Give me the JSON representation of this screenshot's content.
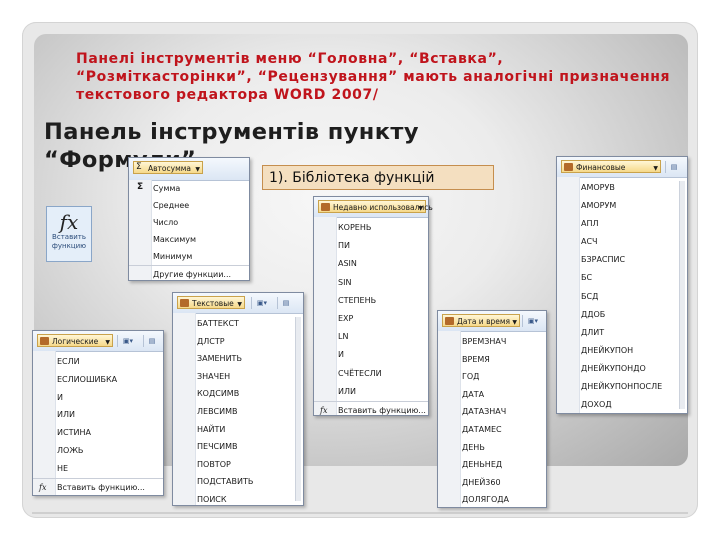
{
  "slide": {
    "intro": "Панелі інструментів меню “Головна”, “Вставка”, “Розміткасторінки”, “Рецензування” мають аналогічні призначення текстового редактора WORD 2007/",
    "title_line1": "Панель інструментів пункту",
    "title_line2": "“Формули”",
    "library_label": "1). Бібліотека функцій"
  },
  "insert_function_button": {
    "symbol": "fx",
    "caption_line1": "Вставить",
    "caption_line2": "функцию"
  },
  "autosum_menu": {
    "header": "Автосумма",
    "icon": "sigma-icon",
    "items": [
      "Сумма",
      "Среднее",
      "Число",
      "Максимум",
      "Минимум"
    ],
    "more": "Другие функции..."
  },
  "recent_menu": {
    "header": "Недавно использовались",
    "items": [
      "КОРЕНЬ",
      "ПИ",
      "ASIN",
      "SIN",
      "СТЕПЕНЬ",
      "EXP",
      "LN",
      "И",
      "СЧЁТЕСЛИ",
      "ИЛИ"
    ],
    "insert": "Вставить функцию..."
  },
  "financial_menu": {
    "header": "Финансовые",
    "items": [
      "АМОРУВ",
      "АМОРУМ",
      "АПЛ",
      "АСЧ",
      "БЗРАСПИС",
      "БС",
      "БСД",
      "ДДОБ",
      "ДЛИТ",
      "ДНЕЙКУПОН",
      "ДНЕЙКУПОНДО",
      "ДНЕЙКУПОНПОСЛЕ",
      "ДОХОД"
    ]
  },
  "text_menu": {
    "header": "Текстовые",
    "items": [
      "БАТТЕКСТ",
      "ДЛСТР",
      "ЗАМЕНИТЬ",
      "ЗНАЧЕН",
      "КОДСИМВ",
      "ЛЕВСИМВ",
      "НАЙТИ",
      "ПЕЧСИМВ",
      "ПОВТОР",
      "ПОДСТАВИТЬ",
      "ПОИСК"
    ]
  },
  "logical_menu": {
    "header": "Логические",
    "items": [
      "ЕСЛИ",
      "ЕСЛИОШИБКА",
      "И",
      "ИЛИ",
      "ИСТИНА",
      "ЛОЖЬ",
      "НЕ"
    ],
    "insert": "Вставить функцию..."
  },
  "datetime_menu": {
    "header": "Дата и время",
    "items": [
      "ВРЕМЗНАЧ",
      "ВРЕМЯ",
      "ГОД",
      "ДАТА",
      "ДАТАЗНАЧ",
      "ДАТАМЕС",
      "ДЕНЬ",
      "ДЕНЬНЕД",
      "ДНЕЙ360",
      "ДОЛЯГОДА"
    ]
  }
}
